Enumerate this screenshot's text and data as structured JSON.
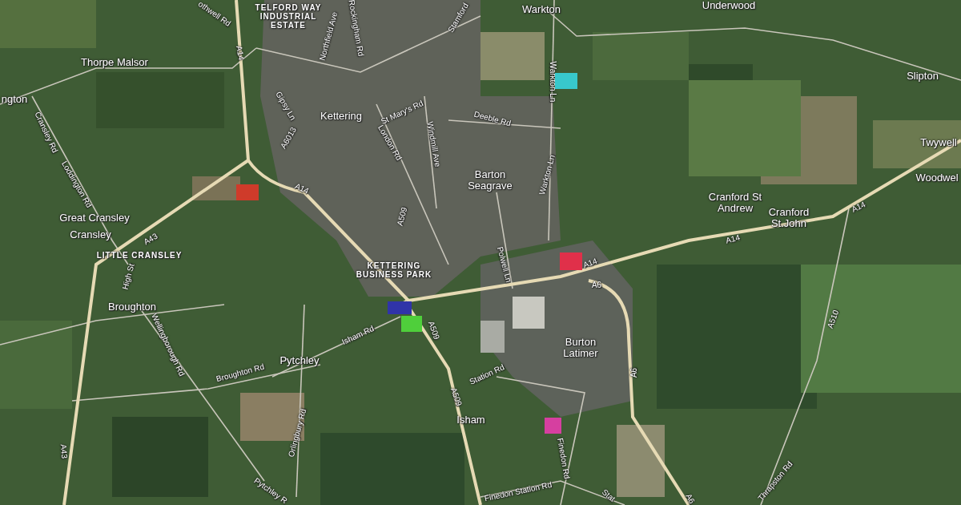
{
  "map": {
    "labels": [
      {
        "text": "othwell Rd",
        "kind": "road"
      },
      {
        "text": "TELFORD WAY INDUSTRIAL ESTATE",
        "kind": "area"
      },
      {
        "text": "Northfield Ave",
        "kind": "road"
      },
      {
        "text": "Rockingham Rd",
        "kind": "road"
      },
      {
        "text": "Stamford",
        "kind": "road"
      },
      {
        "text": "Warkton",
        "kind": "town"
      },
      {
        "text": "Underwood",
        "kind": "town"
      },
      {
        "text": "Thorpe Malsor",
        "kind": "town"
      },
      {
        "text": "A14",
        "kind": "road"
      },
      {
        "text": "ngton",
        "kind": "town"
      },
      {
        "text": "Slipton",
        "kind": "town"
      },
      {
        "text": "Cransley Rd",
        "kind": "road"
      },
      {
        "text": "Gipsy Ln",
        "kind": "road"
      },
      {
        "text": "A6013",
        "kind": "road"
      },
      {
        "text": "Kettering",
        "kind": "town"
      },
      {
        "text": "St Mary's Rd",
        "kind": "road"
      },
      {
        "text": "Deeble Rd",
        "kind": "road"
      },
      {
        "text": "Warkton Ln",
        "kind": "road"
      },
      {
        "text": "London Rd",
        "kind": "road"
      },
      {
        "text": "Windmill Ave",
        "kind": "road"
      },
      {
        "text": "Loddington Rd",
        "kind": "road"
      },
      {
        "text": "Twywell",
        "kind": "town"
      },
      {
        "text": "Warkton Ln",
        "kind": "road"
      },
      {
        "text": "Barton Seagrave",
        "kind": "town"
      },
      {
        "text": "Woodwel",
        "kind": "town"
      },
      {
        "text": "A14",
        "kind": "road"
      },
      {
        "text": "Great Cransley",
        "kind": "town"
      },
      {
        "text": "A509",
        "kind": "road"
      },
      {
        "text": "Cranford St Andrew",
        "kind": "town"
      },
      {
        "text": "Cranford St.John",
        "kind": "town"
      },
      {
        "text": "A14",
        "kind": "road"
      },
      {
        "text": "Cransley",
        "kind": "town"
      },
      {
        "text": "A43",
        "kind": "road"
      },
      {
        "text": "A14",
        "kind": "road"
      },
      {
        "text": "LITTLE CRANSLEY",
        "kind": "area"
      },
      {
        "text": "Polwell Ln",
        "kind": "road"
      },
      {
        "text": "KETTERING BUSINESS PARK",
        "kind": "area"
      },
      {
        "text": "A14",
        "kind": "road"
      },
      {
        "text": "A6",
        "kind": "road"
      },
      {
        "text": "High St",
        "kind": "road"
      },
      {
        "text": "Broughton",
        "kind": "town"
      },
      {
        "text": "Wellingborough Rd",
        "kind": "road"
      },
      {
        "text": "Isham Rd",
        "kind": "road"
      },
      {
        "text": "A509",
        "kind": "road"
      },
      {
        "text": "Burton Latimer",
        "kind": "town"
      },
      {
        "text": "A510",
        "kind": "road"
      },
      {
        "text": "Pytchley",
        "kind": "town"
      },
      {
        "text": "Station Rd",
        "kind": "road"
      },
      {
        "text": "Broughton Rd",
        "kind": "road"
      },
      {
        "text": "A509",
        "kind": "road"
      },
      {
        "text": "A6",
        "kind": "road"
      },
      {
        "text": "A43",
        "kind": "road"
      },
      {
        "text": "Orlingbury Rd",
        "kind": "road"
      },
      {
        "text": "Isham",
        "kind": "town"
      },
      {
        "text": "Finedon Rd",
        "kind": "road"
      },
      {
        "text": "Pytchley R",
        "kind": "road"
      },
      {
        "text": "Thrapston Rd",
        "kind": "road"
      },
      {
        "text": "Finedon Station Rd",
        "kind": "road"
      },
      {
        "text": "Stat",
        "kind": "road"
      },
      {
        "text": "A6",
        "kind": "road"
      }
    ],
    "markers": [
      {
        "color": "#cf3b2a"
      },
      {
        "color": "#38c8cc"
      },
      {
        "color": "#e0304a"
      },
      {
        "color": "#3034a8"
      },
      {
        "color": "#4fcf3b"
      },
      {
        "color": "#d63fa0"
      }
    ]
  }
}
